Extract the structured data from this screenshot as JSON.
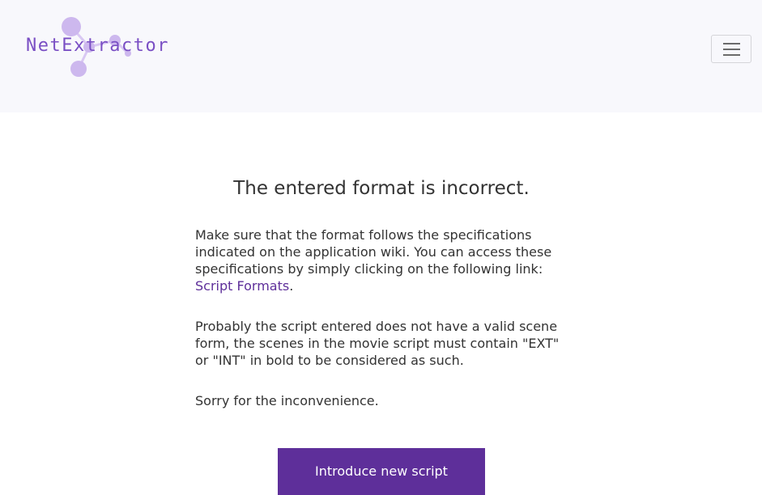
{
  "brand": {
    "logo_text": "NetExtractor",
    "accent_color": "#7a4fc4",
    "node_color": "#cdb8ee"
  },
  "nav": {
    "menu_icon": "hamburger-menu-icon"
  },
  "error": {
    "title": "The entered format is incorrect.",
    "paragraph1_text": "Make sure that the format follows the specifications indicated on the application wiki. You can access these specifications by simply clicking on the following link: ",
    "paragraph1_link": "Script Formats",
    "paragraph1_end": ".",
    "paragraph2": "Probably the script entered does not have a valid scene form, the scenes in the movie script must contain \"EXT\" or \"INT\" in bold to be considered as such.",
    "paragraph3": "Sorry for the inconvenience."
  },
  "actions": {
    "new_script_label": "Introduce new script",
    "button_color": "#5e2f9a"
  }
}
